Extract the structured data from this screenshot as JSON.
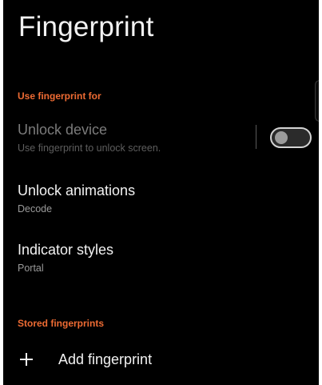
{
  "header": {
    "title": "Fingerprint"
  },
  "section_use": {
    "label": "Use fingerprint for"
  },
  "unlock_device": {
    "title": "Unlock device",
    "summary": "Use fingerprint to unlock screen.",
    "switch_on": false,
    "enabled": false
  },
  "unlock_animations": {
    "title": "Unlock animations",
    "summary": "Decode"
  },
  "indicator_styles": {
    "title": "Indicator styles",
    "summary": "Portal"
  },
  "section_stored": {
    "label": "Stored fingerprints"
  },
  "add_fingerprint": {
    "label": "Add fingerprint",
    "icon": "plus-icon"
  },
  "colors": {
    "accent": "#ee6b33",
    "background": "#000000",
    "text_primary": "#f2f2f2",
    "text_secondary": "#9a9a9a"
  }
}
